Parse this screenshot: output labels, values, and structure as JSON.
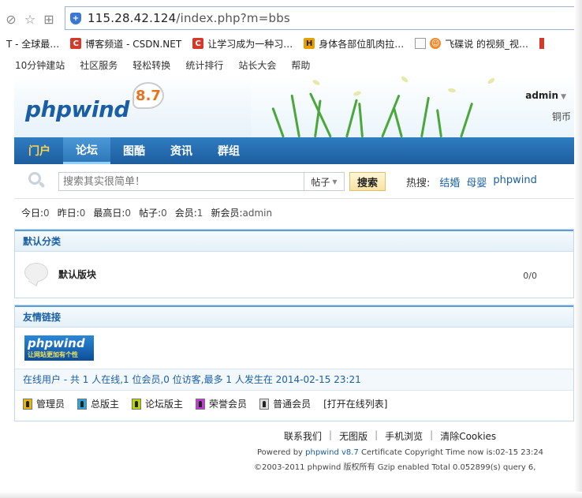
{
  "browser": {
    "url_host": "115.28.42.124",
    "url_path": "/index.php?m=bbs",
    "bookmarks": [
      {
        "label": "T - 全球最…",
        "icon": "none"
      },
      {
        "label": "博客频道 - CSDN.NET",
        "icon": "csdn-icon"
      },
      {
        "label": "让学习成为一种习…",
        "icon": "csdn-icon"
      },
      {
        "label": "身体各部位肌肉拉…",
        "icon": "site-icon"
      },
      {
        "label": "飞碟说 的视频_视…",
        "icon": "page-icon"
      }
    ]
  },
  "topnav": [
    "10分钟建站",
    "社区服务",
    "轻松转换",
    "统计排行",
    "站长大会",
    "帮助"
  ],
  "header": {
    "logo": "phpwind",
    "version": "8.7",
    "username": "admin",
    "coin_label": "铜币"
  },
  "mainnav": [
    "门户",
    "论坛",
    "图酷",
    "资讯",
    "群组"
  ],
  "search": {
    "placeholder": "搜索其实很简单！",
    "type": "帖子",
    "button": "搜索",
    "hot_label": "热搜:",
    "hot": [
      "结婚",
      "母婴",
      "phpwind"
    ]
  },
  "stats": [
    {
      "label": "今日:",
      "value": "0"
    },
    {
      "label": "昨日:",
      "value": "0"
    },
    {
      "label": "最高日:",
      "value": "0"
    },
    {
      "label": "帖子:",
      "value": "0"
    },
    {
      "label": "会员:",
      "value": "1"
    },
    {
      "label": "新会员:",
      "value": "admin"
    }
  ],
  "category": {
    "title": "默认分类",
    "forum_name": "默认版块",
    "forum_count": "0/0"
  },
  "links": {
    "title": "友情链接",
    "logo_text": "phpwind",
    "logo_sub": "让网站更加有个性",
    "online": "在线用户 - 共  1 人在线,1 位会员,0 位访客,最多  1 人发生在  2014-02-15 23:21",
    "legend": [
      "管理员",
      "总版主",
      "论坛版主",
      "荣誉会员",
      "普通会员",
      "[打开在线列表]"
    ],
    "legend_colors": [
      "#e8b800",
      "#2aa7d6",
      "#b8d800",
      "#c23ad6",
      "#dddddd"
    ]
  },
  "footer": {
    "links": [
      "联系我们",
      "无图版",
      "手机浏览",
      "清除Cookies"
    ],
    "powered_pre": "Powered by ",
    "powered_brand": "phpwind v8.7",
    "powered_post": " Certificate Copyright Time now is:02-15 23:24",
    "copyright": "©2003-2011 phpwind 版权所有  Gzip enabled Total 0.052899(s) query 6,"
  }
}
